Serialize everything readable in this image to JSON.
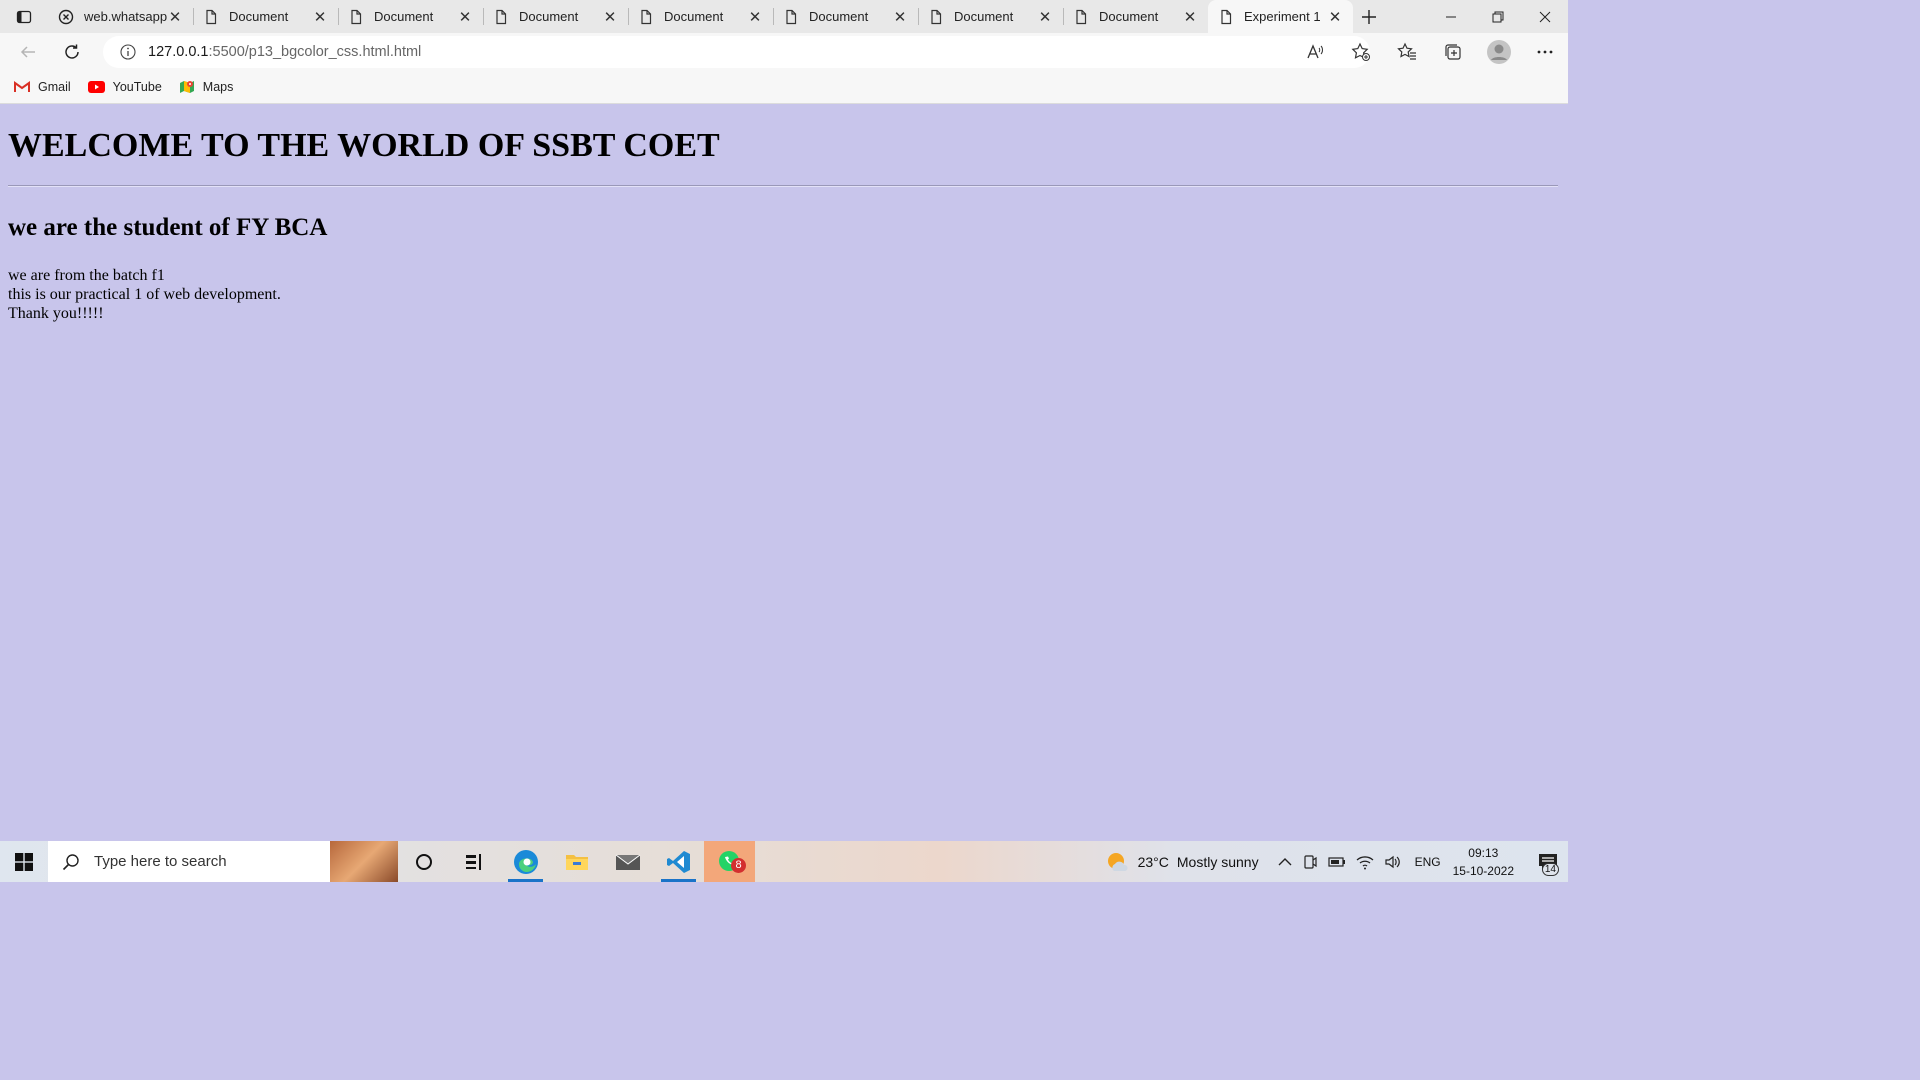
{
  "browser": {
    "tabs": [
      {
        "title": "web.whatsapp",
        "icon": "whatsapp-icon"
      },
      {
        "title": "Document",
        "icon": "page-icon"
      },
      {
        "title": "Document",
        "icon": "page-icon"
      },
      {
        "title": "Document",
        "icon": "page-icon"
      },
      {
        "title": "Document",
        "icon": "page-icon"
      },
      {
        "title": "Document",
        "icon": "page-icon"
      },
      {
        "title": "Document",
        "icon": "page-icon"
      },
      {
        "title": "Document",
        "icon": "page-icon"
      },
      {
        "title": "Experiment 1",
        "icon": "page-icon",
        "active": true
      }
    ],
    "url": {
      "host": "127.0.0.1",
      "path": ":5500/p13_bgcolor_css.html.html"
    },
    "bookmarks": [
      {
        "label": "Gmail",
        "icon": "gmail-icon"
      },
      {
        "label": "YouTube",
        "icon": "youtube-icon"
      },
      {
        "label": "Maps",
        "icon": "maps-icon"
      }
    ]
  },
  "page": {
    "background": "#c8c5eb",
    "heading": "WELCOME TO THE WORLD OF SSBT COET",
    "subheading": "we are the student of FY BCA",
    "lines": [
      "we are from the batch f1",
      "this is our practical 1 of web development.",
      "Thank you!!!!!"
    ]
  },
  "taskbar": {
    "search_placeholder": "Type here to search",
    "whatsapp_badge": "8",
    "weather": {
      "temp": "23°C",
      "condition": "Mostly sunny"
    },
    "language": "ENG",
    "time": "09:13",
    "date": "15-10-2022",
    "notification_count": "14"
  }
}
